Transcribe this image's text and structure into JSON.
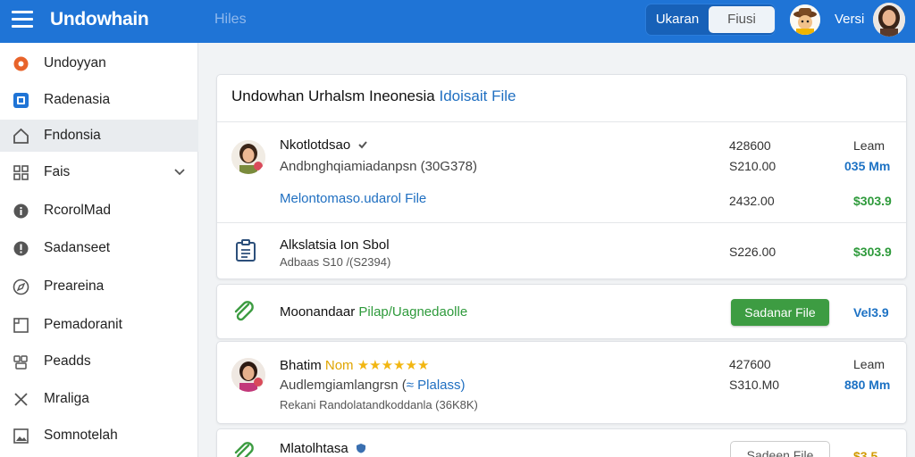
{
  "header": {
    "app_title": "Undowhain",
    "crumb": "Hiles",
    "btn_primary": "Ukaran",
    "btn_secondary": "Fiusi",
    "user_name": "Versi",
    "bar_color": "#1f74d6"
  },
  "sidebar": {
    "items": [
      {
        "label": "Undoyyan",
        "icon": "circle-dot-icon"
      },
      {
        "label": "Radenasia",
        "icon": "square-icon"
      },
      {
        "label": "Fndonsia",
        "icon": "home-icon"
      },
      {
        "label": "Fais",
        "icon": "grid-icon"
      },
      {
        "label": "RcorolMad",
        "icon": "info-icon"
      },
      {
        "label": "Sadanseet",
        "icon": "alert-icon"
      },
      {
        "label": "Preareina",
        "icon": "compass-icon"
      },
      {
        "label": "Pemadoranit",
        "icon": "frame-icon"
      },
      {
        "label": "Peadds",
        "icon": "group-icon"
      },
      {
        "label": "Mraliga",
        "icon": "close-icon"
      },
      {
        "label": "Somnotelah",
        "icon": "image-icon"
      }
    ]
  },
  "card1": {
    "title": "Undowhan Urhalsm Ineonesia",
    "title_link": "Idoisait File",
    "entry1": {
      "name": "Nkotlotdsao",
      "desc": "Andbnghqiamiadanpsn (30G378)",
      "link": "Melontomaso.udarol File",
      "num1": "428600",
      "num2": "S210.00",
      "num3": "2432.00",
      "col_label": "Leam",
      "blue_value": "035 Mm",
      "green_value": "$303.9"
    },
    "entry2": {
      "name": "Alkslatsia Ion Sbol",
      "sub": "Adbaas S10 /(S2394)",
      "num1": "S226.00",
      "green_value": "$303.9"
    }
  },
  "card2": {
    "name": "Moonandaar",
    "link": "Pilap/Uagnedaolle",
    "button": "Sadanar File",
    "value": "Vel3.9"
  },
  "card3": {
    "name": "Bhatim",
    "badge": "Nom",
    "stars": "★★★★★★",
    "desc_a": "Audlemgiamlangrsn (",
    "desc_link": "≈ Plalass)",
    "sub": "Rekani Randolatandkoddanla (36K8K)",
    "num1": "427600",
    "num2": "S310.M0",
    "col_label": "Leam",
    "blue_value": "880 Mm"
  },
  "card4": {
    "name": "Mlatolhtasa",
    "button": "Sadeen File",
    "value": "$3.5"
  }
}
